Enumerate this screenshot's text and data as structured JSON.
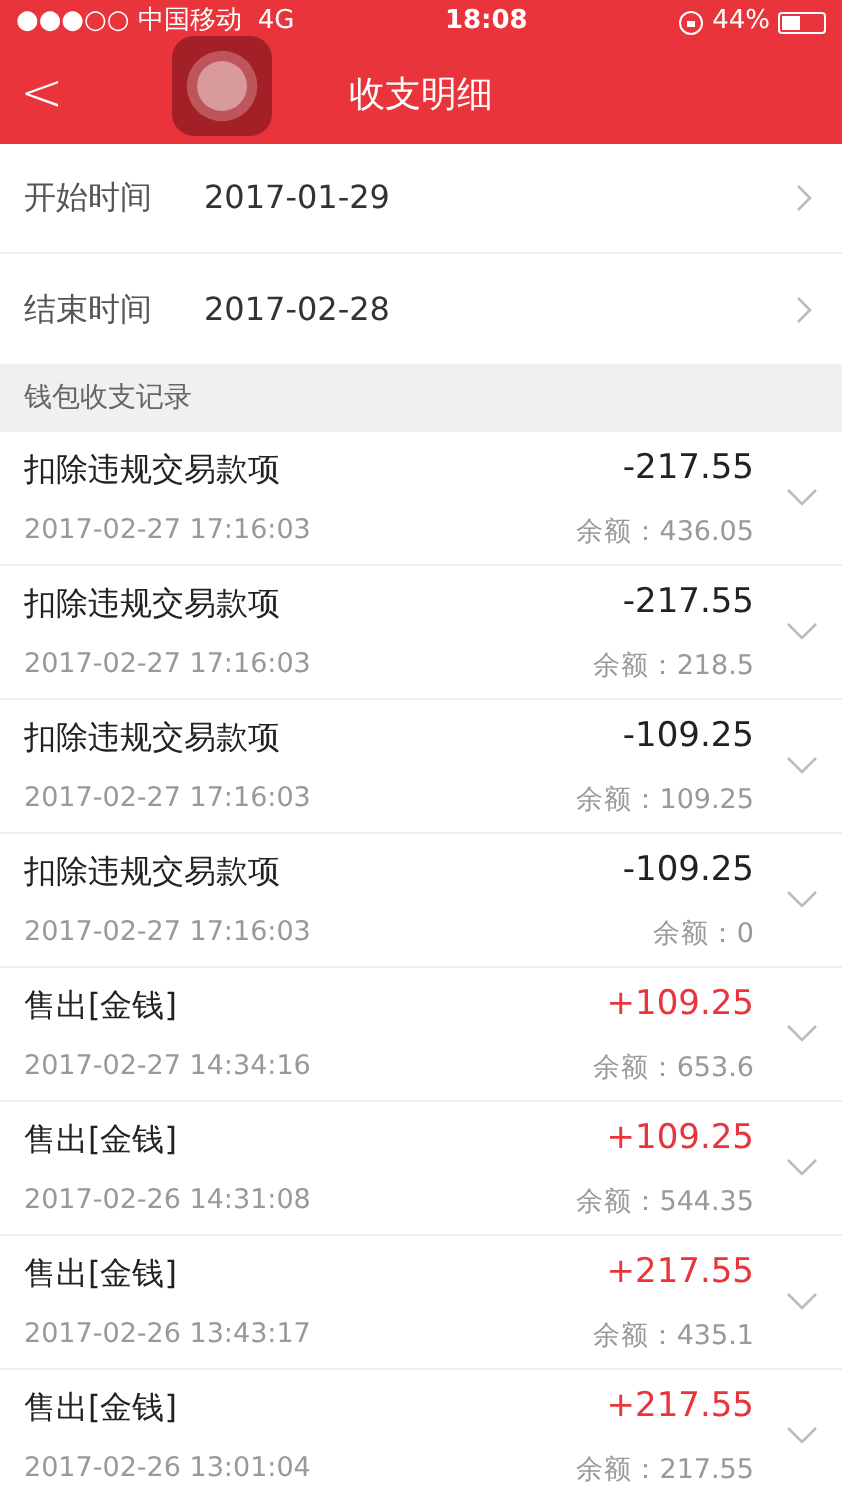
{
  "status_bar": {
    "carrier": "●●●○○ 中国移动",
    "network": "4G",
    "time": "18:08",
    "battery": "44%"
  },
  "nav": {
    "title": "收支明细",
    "back": "<"
  },
  "filters": [
    {
      "label": "开始时间",
      "value": "2017-01-29"
    },
    {
      "label": "结束时间",
      "value": "2017-02-28"
    }
  ],
  "section_title": "钱包收支记录",
  "records": [
    {
      "title": "扣除违规交易款项",
      "time": "2017-02-27 17:16:03",
      "amount": "-217.55",
      "kind": "expense",
      "balance": "余额：436.05"
    },
    {
      "title": "扣除违规交易款项",
      "time": "2017-02-27 17:16:03",
      "amount": "-217.55",
      "kind": "expense",
      "balance": "余额：218.5"
    },
    {
      "title": "扣除违规交易款项",
      "time": "2017-02-27 17:16:03",
      "amount": "-109.25",
      "kind": "expense",
      "balance": "余额：109.25"
    },
    {
      "title": "扣除违规交易款项",
      "time": "2017-02-27 17:16:03",
      "amount": "-109.25",
      "kind": "expense",
      "balance": "余额：0"
    },
    {
      "title": "售出[金钱]",
      "time": "2017-02-27 14:34:16",
      "amount": "+109.25",
      "kind": "income",
      "balance": "余额：653.6"
    },
    {
      "title": "售出[金钱]",
      "time": "2017-02-26 14:31:08",
      "amount": "+109.25",
      "kind": "income",
      "balance": "余额：544.35"
    },
    {
      "title": "售出[金钱]",
      "time": "2017-02-26 13:43:17",
      "amount": "+217.55",
      "kind": "income",
      "balance": "余额：435.1"
    },
    {
      "title": "售出[金钱]",
      "time": "2017-02-26 13:01:04",
      "amount": "+217.55",
      "kind": "income",
      "balance": "余额：217.55"
    }
  ]
}
